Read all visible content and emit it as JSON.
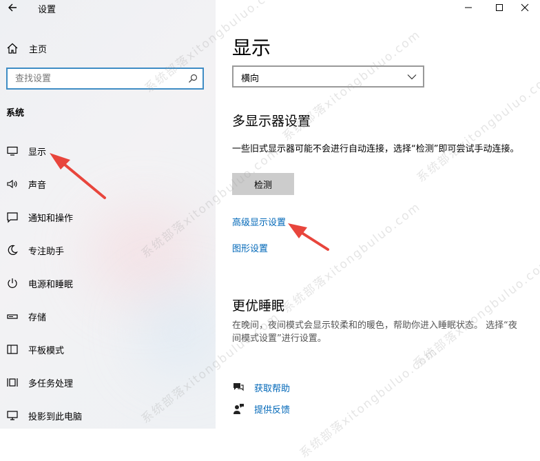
{
  "window": {
    "title": "设置"
  },
  "sidebar": {
    "home_label": "主页",
    "search_placeholder": "查找设置",
    "category": "系统",
    "items": [
      {
        "label": "显示",
        "icon": "monitor-icon"
      },
      {
        "label": "声音",
        "icon": "speaker-icon"
      },
      {
        "label": "通知和操作",
        "icon": "notification-icon"
      },
      {
        "label": "专注助手",
        "icon": "moon-icon"
      },
      {
        "label": "电源和睡眠",
        "icon": "power-icon"
      },
      {
        "label": "存储",
        "icon": "storage-icon"
      },
      {
        "label": "平板模式",
        "icon": "tablet-icon"
      },
      {
        "label": "多任务处理",
        "icon": "multitask-icon"
      },
      {
        "label": "投影到此电脑",
        "icon": "project-icon"
      }
    ]
  },
  "main": {
    "title": "显示",
    "orientation_value": "横向",
    "multi_display": {
      "heading": "多显示器设置",
      "description": "一些旧式显示器可能不会进行自动连接，选择“检测”即可尝试手动连接。",
      "detect_button": "检测"
    },
    "links": {
      "advanced_display": "高级显示设置",
      "graphics": "图形设置"
    },
    "sleep": {
      "heading": "更优睡眠",
      "description": "在晚间，夜间模式会显示较柔和的暖色，帮助你进入睡眠状态。 选择“夜间模式设置”进行设置。"
    },
    "help": {
      "get_help": "获取帮助",
      "feedback": "提供反馈"
    }
  },
  "watermark": "系统部落xitongbuluo.com",
  "colors": {
    "accent": "#0067b8",
    "arrow": "#e8453c",
    "focus_border": "#3e8cc4"
  }
}
